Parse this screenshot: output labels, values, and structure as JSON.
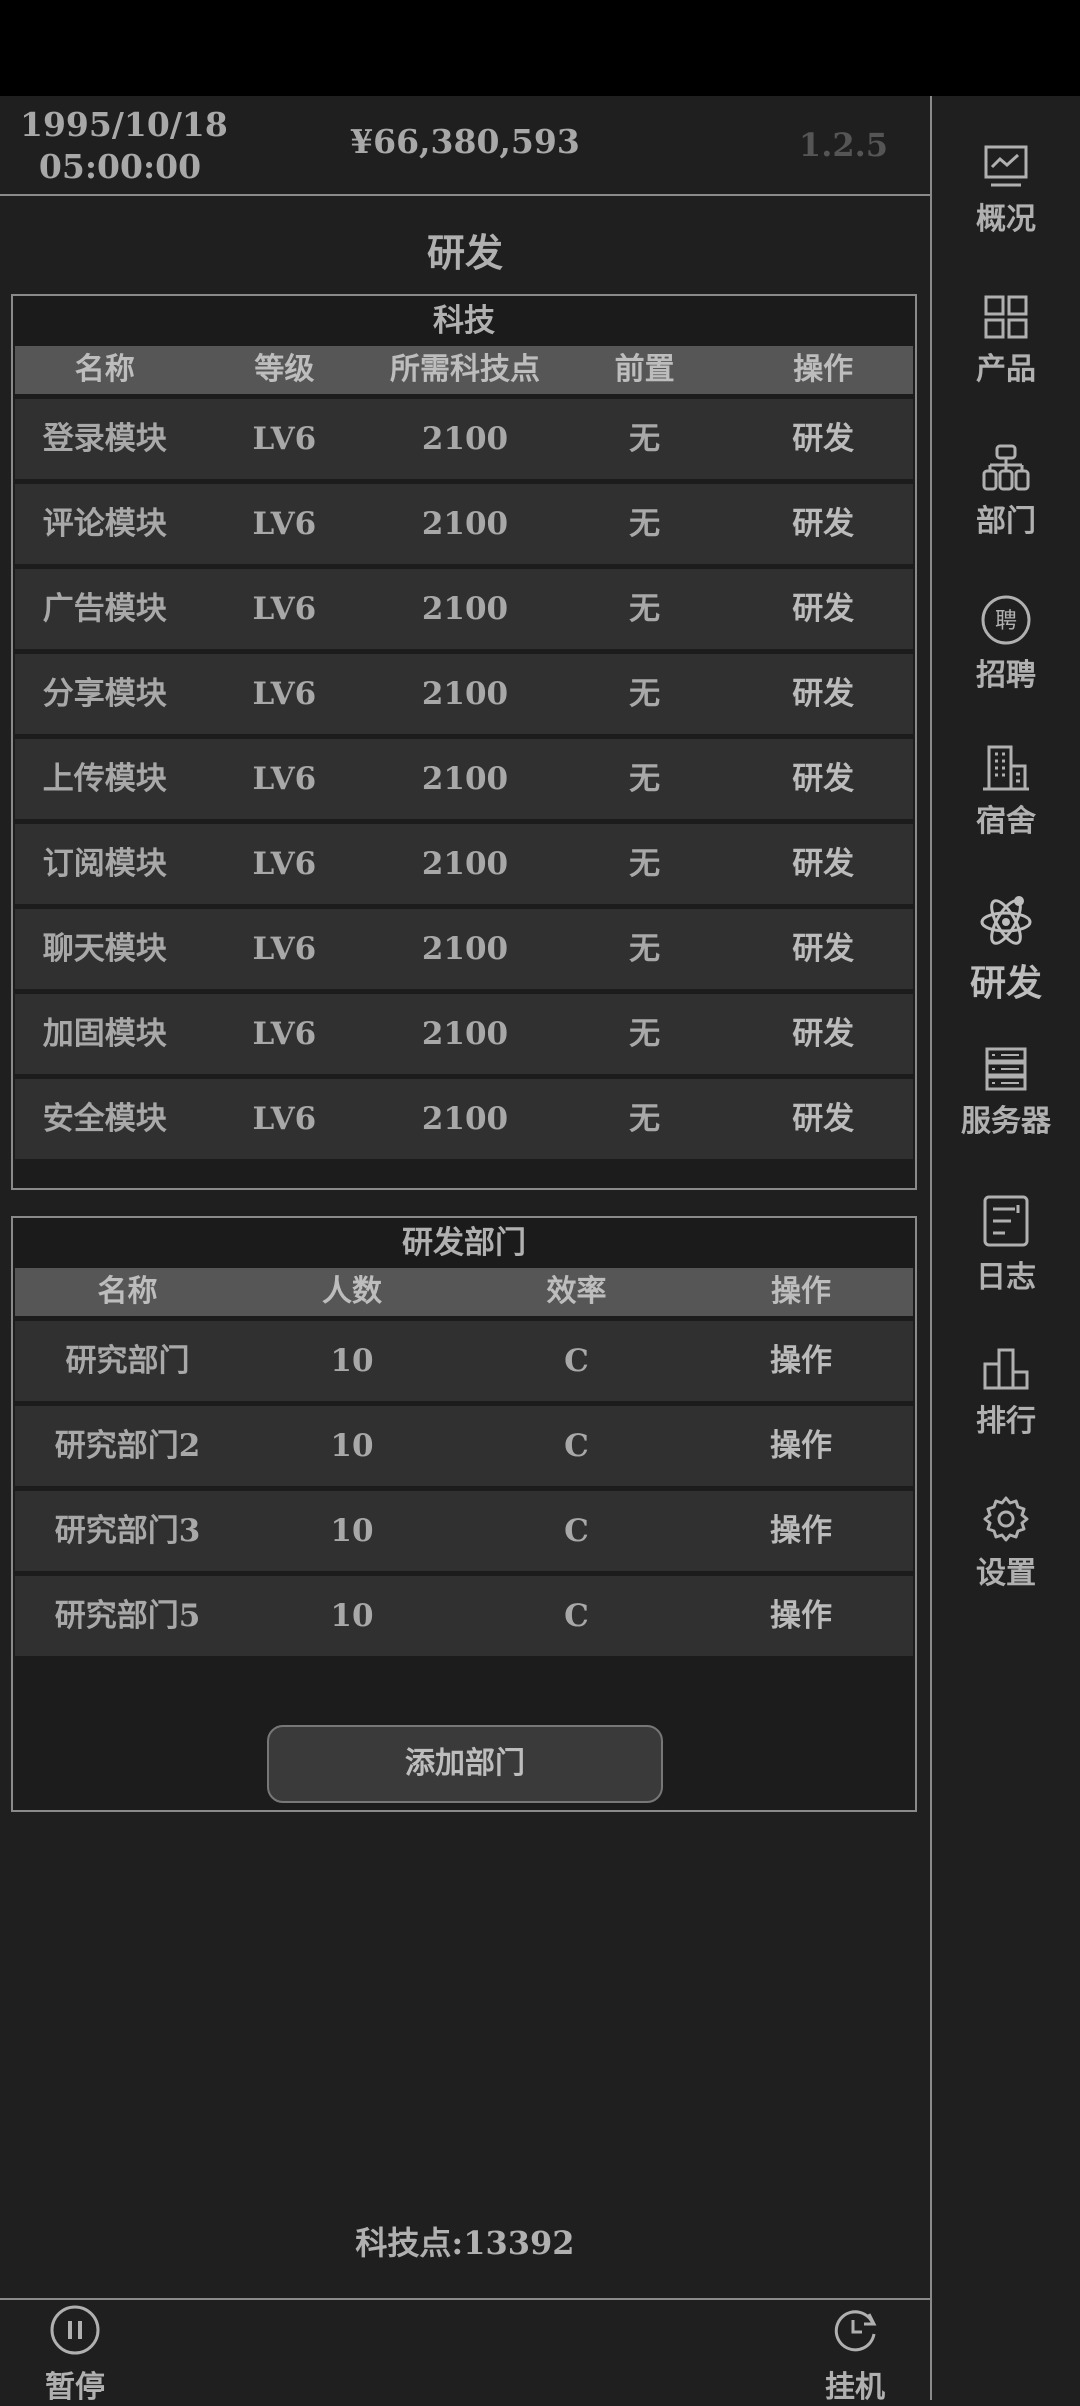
{
  "header": {
    "date": "1995/10/18",
    "time": "05:00:00",
    "money": "¥66,380,593",
    "version": "1.2.5"
  },
  "page_title": "研发",
  "tech_table": {
    "title": "科技",
    "columns": [
      "名称",
      "等级",
      "所需科技点",
      "前置",
      "操作"
    ],
    "rows": [
      {
        "name": "登录模块",
        "level": "LV6",
        "points": "2100",
        "prereq": "无",
        "action": "研发"
      },
      {
        "name": "评论模块",
        "level": "LV6",
        "points": "2100",
        "prereq": "无",
        "action": "研发"
      },
      {
        "name": "广告模块",
        "level": "LV6",
        "points": "2100",
        "prereq": "无",
        "action": "研发"
      },
      {
        "name": "分享模块",
        "level": "LV6",
        "points": "2100",
        "prereq": "无",
        "action": "研发"
      },
      {
        "name": "上传模块",
        "level": "LV6",
        "points": "2100",
        "prereq": "无",
        "action": "研发"
      },
      {
        "name": "订阅模块",
        "level": "LV6",
        "points": "2100",
        "prereq": "无",
        "action": "研发"
      },
      {
        "name": "聊天模块",
        "level": "LV6",
        "points": "2100",
        "prereq": "无",
        "action": "研发"
      },
      {
        "name": "加固模块",
        "level": "LV6",
        "points": "2100",
        "prereq": "无",
        "action": "研发"
      },
      {
        "name": "安全模块",
        "level": "LV6",
        "points": "2100",
        "prereq": "无",
        "action": "研发"
      }
    ]
  },
  "dept_table": {
    "title": "研发部门",
    "columns": [
      "名称",
      "人数",
      "效率",
      "操作"
    ],
    "rows": [
      {
        "name": "研究部门",
        "count": "10",
        "efficiency": "C",
        "action": "操作"
      },
      {
        "name": "研究部门2",
        "count": "10",
        "efficiency": "C",
        "action": "操作"
      },
      {
        "name": "研究部门3",
        "count": "10",
        "efficiency": "C",
        "action": "操作"
      },
      {
        "name": "研究部门5",
        "count": "10",
        "efficiency": "C",
        "action": "操作"
      }
    ],
    "add_button": "添加部门"
  },
  "tech_points": "科技点:13392",
  "bottom": {
    "pause_label": "暂停",
    "idle_label": "挂机"
  },
  "sidebar": {
    "items": [
      {
        "label": "概况",
        "icon": "chart-monitor-icon"
      },
      {
        "label": "产品",
        "icon": "grid-icon"
      },
      {
        "label": "部门",
        "icon": "org-chart-icon"
      },
      {
        "label": "招聘",
        "icon": "hire-icon",
        "icon_char": "聘"
      },
      {
        "label": "宿舍",
        "icon": "building-icon"
      },
      {
        "label": "研发",
        "icon": "atom-icon",
        "active": true
      },
      {
        "label": "服务器",
        "icon": "server-icon"
      },
      {
        "label": "日志",
        "icon": "log-icon"
      },
      {
        "label": "排行",
        "icon": "ranking-icon"
      },
      {
        "label": "设置",
        "icon": "gear-icon"
      }
    ]
  },
  "colors": {
    "background": "#1f1f1f",
    "row": "#303030",
    "header_row": "#565656",
    "text": "#a8a8a8",
    "border": "#8a8a8a"
  }
}
